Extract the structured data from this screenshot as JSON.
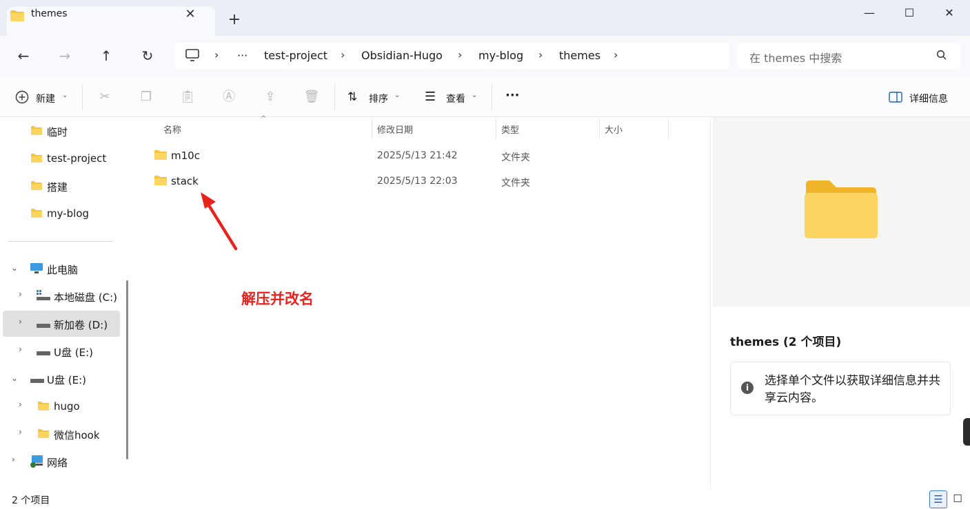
{
  "window": {
    "tab_title": "themes",
    "minimize": "—",
    "maximize": "☐",
    "close": "✕"
  },
  "breadcrumb": {
    "items": [
      "test-project",
      "Obsidian-Hugo",
      "my-blog",
      "themes"
    ],
    "overflow": "···"
  },
  "search": {
    "placeholder": "在 themes 中搜索"
  },
  "commands": {
    "new": "新建",
    "sort": "排序",
    "view": "查看",
    "more": "···",
    "details": "详细信息"
  },
  "sidebar": {
    "items": [
      {
        "label": "临时"
      },
      {
        "label": "test-project"
      },
      {
        "label": "搭建"
      },
      {
        "label": "my-blog"
      },
      {
        "label": "此电脑"
      },
      {
        "label": "本地磁盘 (C:)"
      },
      {
        "label": "新加卷 (D:)"
      },
      {
        "label": "U盘 (E:)"
      },
      {
        "label": "U盘 (E:)"
      },
      {
        "label": "hugo"
      },
      {
        "label": "微信hook"
      },
      {
        "label": "网络"
      }
    ]
  },
  "list": {
    "columns": {
      "name": "名称",
      "date": "修改日期",
      "type": "类型",
      "size": "大小"
    },
    "rows": [
      {
        "name": "m10c",
        "date": "2025/5/13 21:42",
        "type": "文件夹"
      },
      {
        "name": "stack",
        "date": "2025/5/13 22:03",
        "type": "文件夹"
      }
    ]
  },
  "annotation": "解压并改名",
  "details": {
    "title": "themes (2 个项目)",
    "info": "选择单个文件以获取详细信息并共享云内容。"
  },
  "status": {
    "count": "2 个项目"
  },
  "colors": {
    "annotation": "#e8231e",
    "folder": "#f5c542",
    "selected": "#e0e0e0"
  }
}
